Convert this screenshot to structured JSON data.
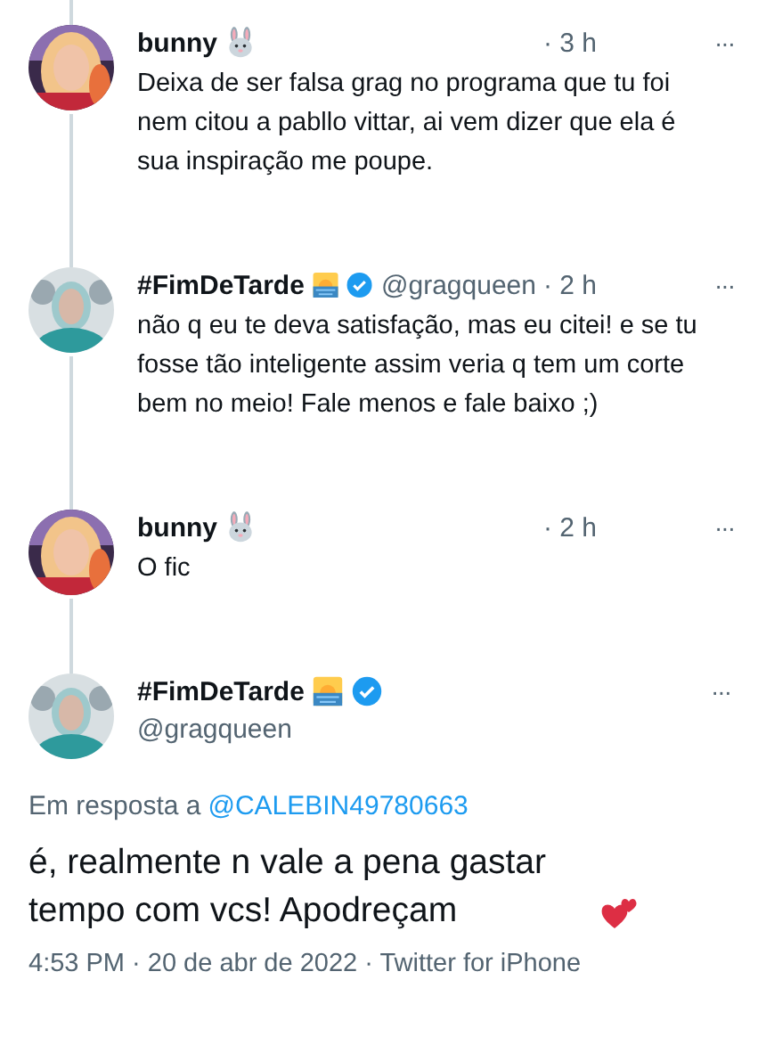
{
  "replies": [
    {
      "kind": "rabbit",
      "name": "bunny",
      "verified": false,
      "time": "· 3 h",
      "text": "Deixa de ser falsa grag no programa que tu foi nem citou a pabllo vittar, ai vem dizer que ela é sua inspiração me poupe.",
      "more": "···"
    },
    {
      "kind": "sunrise",
      "name": "#FimDeTarde",
      "verified": true,
      "handle": "@gragqueen",
      "time": "· 2 h",
      "text": "não q eu te deva satisfação, mas eu citei! e se tu fosse tão inteligente assim veria q tem um corte bem no meio! Fale menos e fale baixo ;)",
      "more": "···"
    },
    {
      "kind": "rabbit",
      "name": "bunny",
      "verified": false,
      "time": "· 2 h",
      "text": "O fic",
      "more": "···"
    }
  ],
  "main": {
    "kind": "sunrise",
    "name": "#FimDeTarde",
    "verified": true,
    "handle": "@gragqueen",
    "more": "···",
    "reply_to_label": "Em resposta a",
    "reply_to_user": "@CALEBIN49780663",
    "text": "é, realmente n vale a pena gastar tempo com vcs! Apodreçam",
    "footer": "4:53 PM · 20 de abr de 2022 · Twitter for iPhone"
  }
}
